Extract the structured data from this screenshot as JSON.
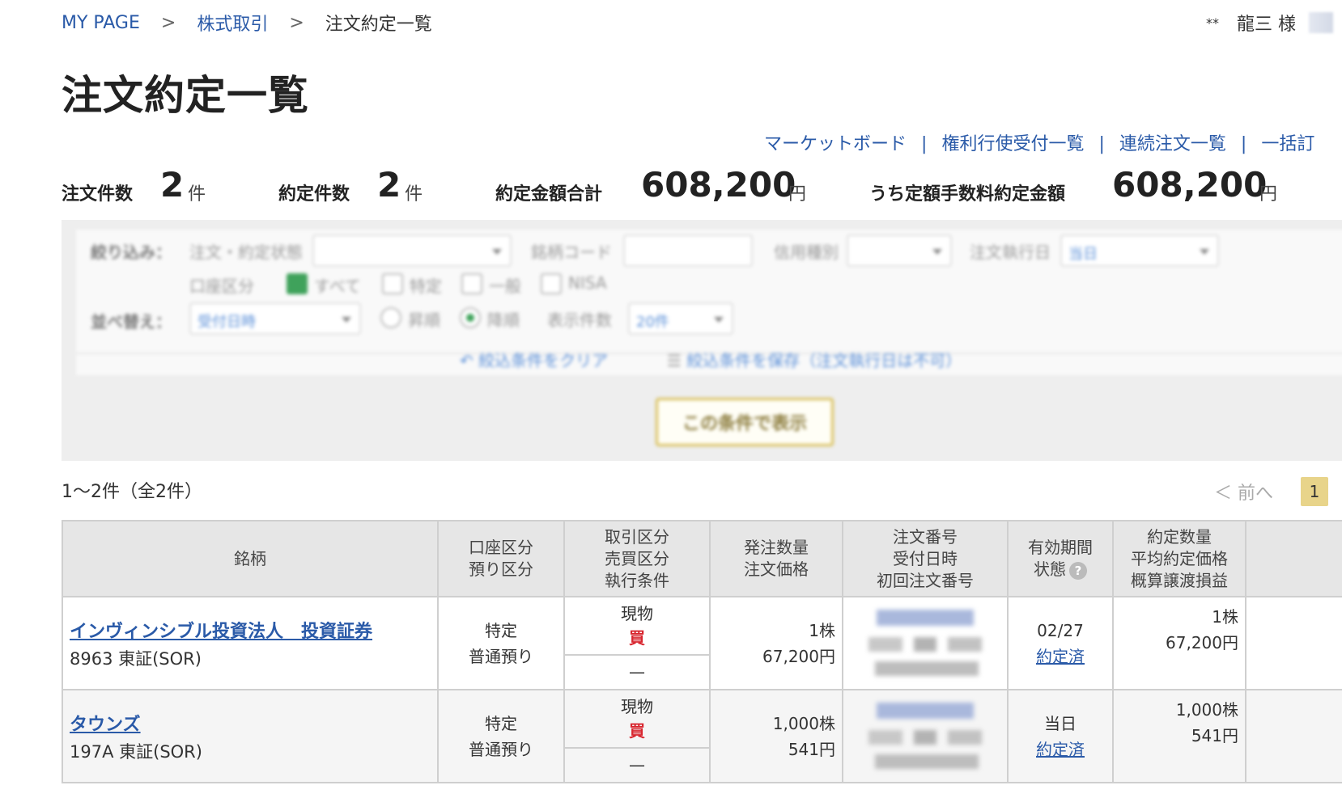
{
  "breadcrumb": {
    "items": [
      "MY PAGE",
      "株式取引"
    ],
    "separator": ">",
    "current": "注文約定一覧"
  },
  "user": {
    "stars": "**",
    "name": "龍三 様"
  },
  "page_title": "注文約定一覧",
  "quick_links": [
    "マーケットボード",
    "権利行使受付一覧",
    "連続注文一覧",
    "一括訂"
  ],
  "summary": {
    "order_count_label": "注文件数",
    "order_count": "2",
    "unit_count": "件",
    "exec_count_label": "約定件数",
    "exec_count": "2",
    "total_label": "約定金額合計",
    "total_value": "608,200",
    "unit_yen": "円",
    "fixed_label": "うち定額手数料約定金額",
    "fixed_value": "608,200"
  },
  "filter": {
    "narrow_label": "絞り込み：",
    "status_label": "注文・約定状態",
    "code_label": "銘柄コード",
    "credit_label": "信用種別",
    "date_label": "注文執行日",
    "date_value": "当日",
    "account_label": "口座区分",
    "chk_all": "すべて",
    "chk_specific": "特定",
    "chk_general": "一般",
    "chk_nisa": "NISA",
    "sort_label": "並べ替え：",
    "sort_value": "受付日時",
    "asc": "昇順",
    "desc": "降順",
    "display_label": "表示件数",
    "display_value": "20件",
    "clear_link": "絞込条件をクリア",
    "save_link": "絞込条件を保存（注文執行日は不可）",
    "submit": "この条件で表示"
  },
  "result_count": "1〜2件（全2件）",
  "pager": {
    "prev": "＜ 前へ",
    "current_page": "1"
  },
  "table": {
    "headers": {
      "stock": "銘柄",
      "account_1": "口座区分",
      "account_2": "預り区分",
      "trade_1": "取引区分",
      "trade_2": "売買区分",
      "trade_3": "執行条件",
      "qty_1": "発注数量",
      "qty_2": "注文価格",
      "ord_1": "注文番号",
      "ord_2": "受付日時",
      "ord_3": "初回注文番号",
      "valid_1": "有効期間",
      "valid_2": "状態",
      "exec_1": "約定数量",
      "exec_2": "平均約定価格",
      "exec_3": "概算譲渡損益"
    },
    "rows": [
      {
        "name": "インヴィンシブル投資法人　投資証券",
        "code": "8963 東証(SOR)",
        "account": "特定",
        "deposit": "普通預り",
        "trade_type": "現物",
        "side": "買",
        "condition": "—",
        "qty": "1株",
        "price": "67,200円",
        "period": "02/27",
        "status": "約定済",
        "exec_qty": "1株",
        "avg_price": "67,200円"
      },
      {
        "name": "タウンズ",
        "code": "197A 東証(SOR)",
        "account": "特定",
        "deposit": "普通預り",
        "trade_type": "現物",
        "side": "買",
        "condition": "—",
        "qty": "1,000株",
        "price": "541円",
        "period": "当日",
        "status": "約定済",
        "exec_qty": "1,000株",
        "avg_price": "541円"
      }
    ]
  }
}
